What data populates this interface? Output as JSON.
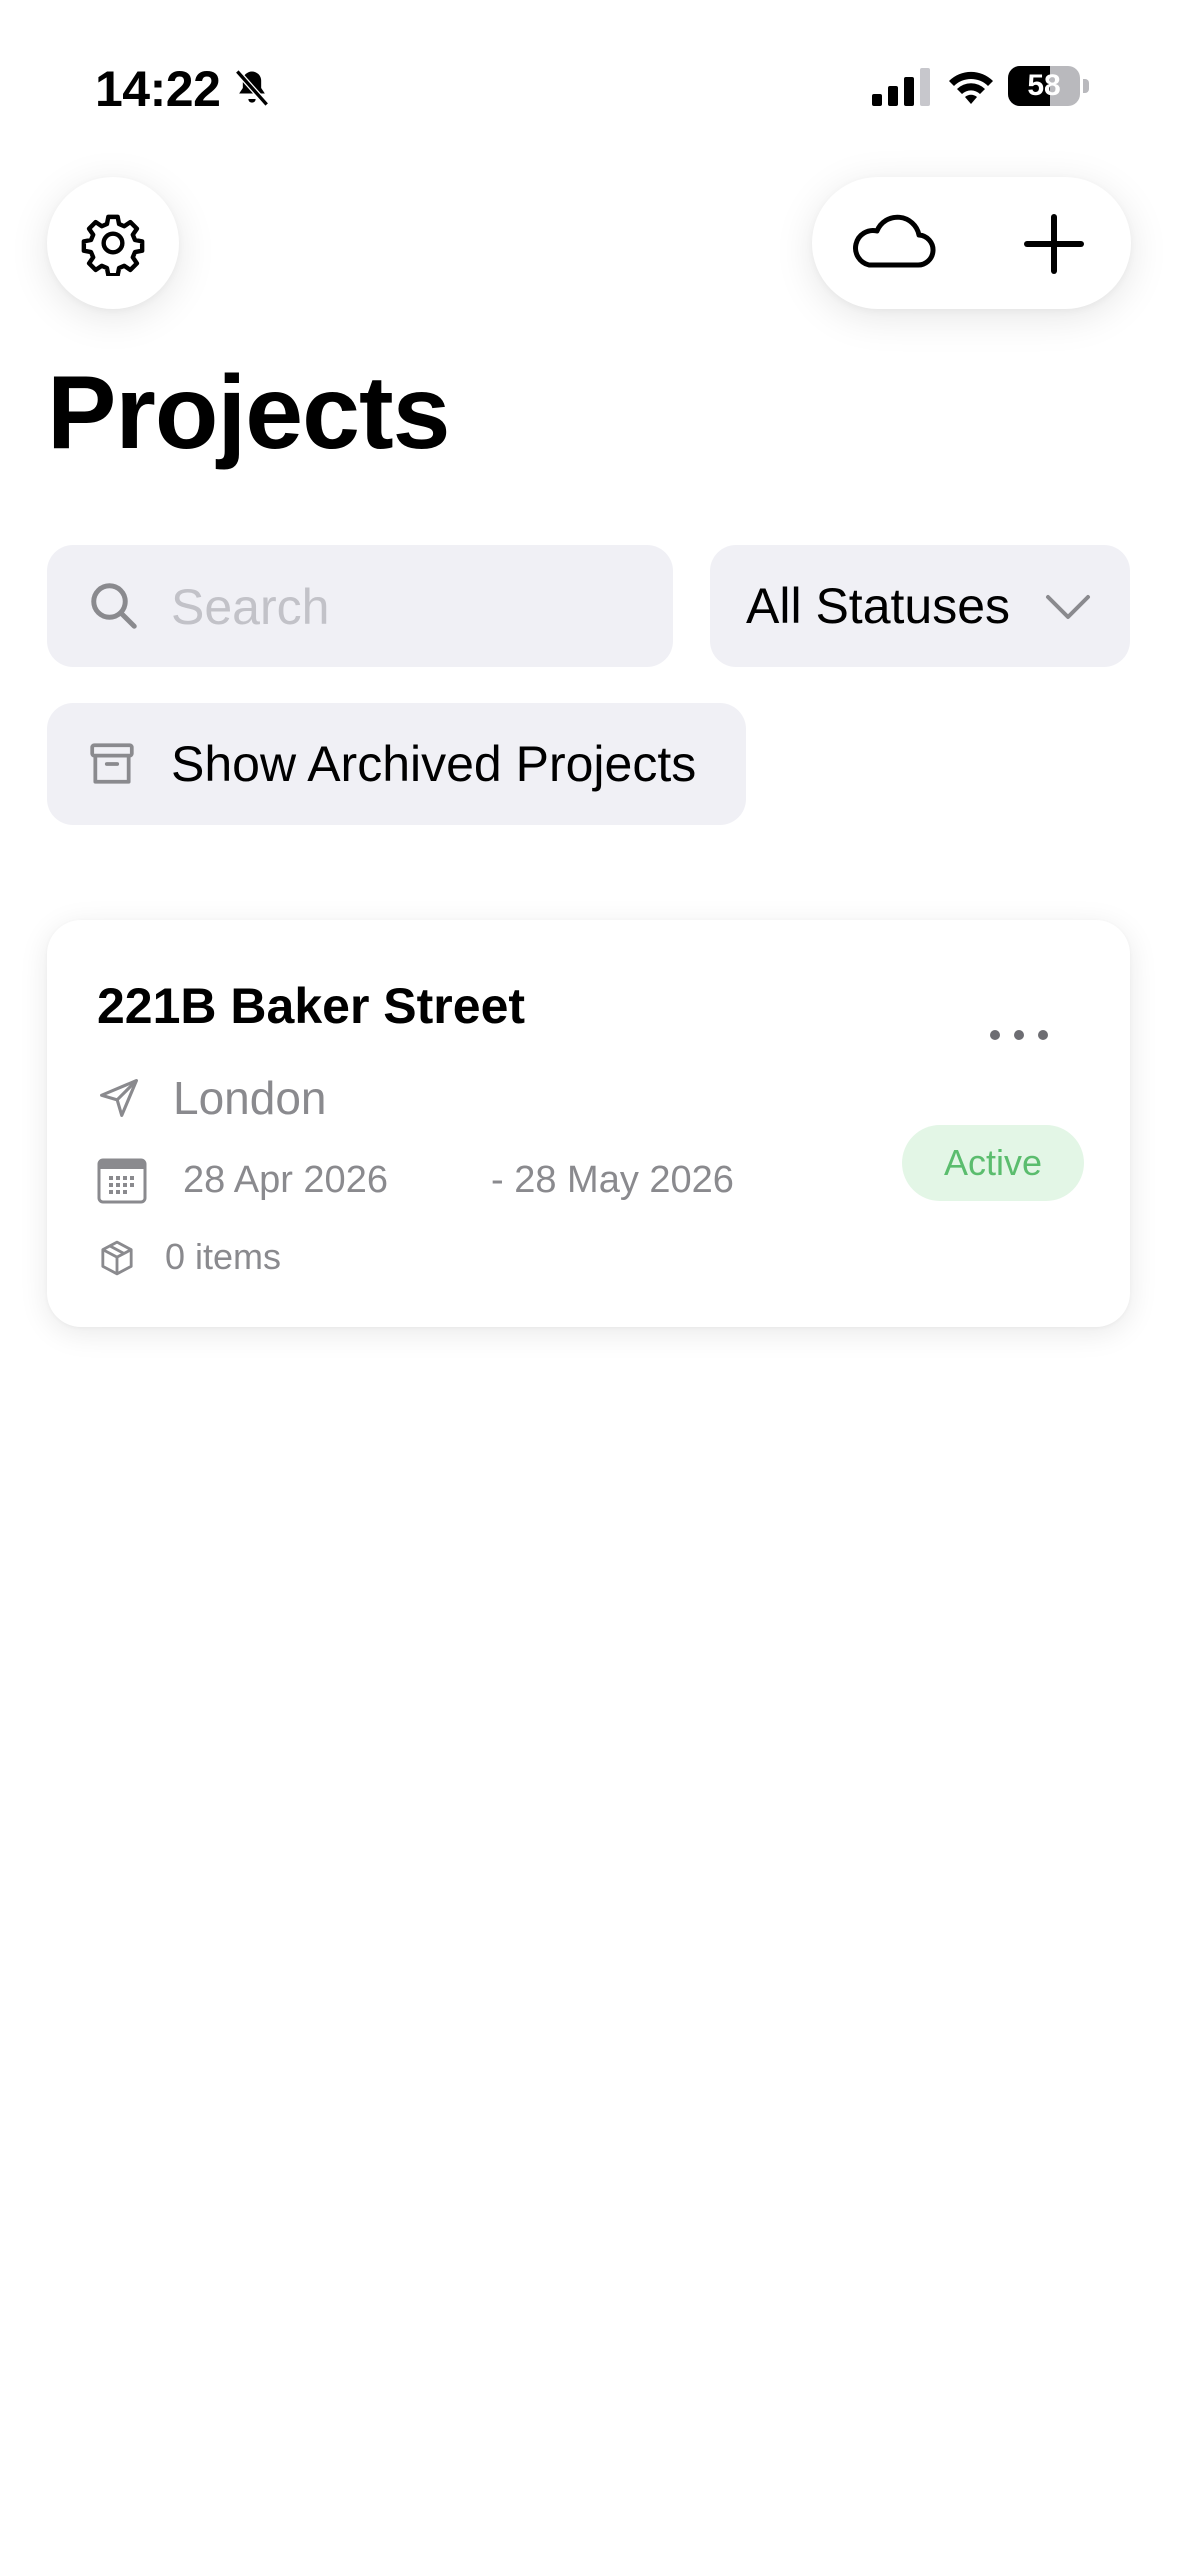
{
  "status_bar": {
    "time": "14:22",
    "battery_percent": 58,
    "battery_label": "58",
    "icons": [
      "bell-slash-icon",
      "cellular-signal-icon",
      "wifi-icon",
      "battery-icon"
    ]
  },
  "header": {
    "settings_icon": "gear-icon",
    "sync_icon": "cloud-icon",
    "add_icon": "plus-icon"
  },
  "page": {
    "title": "Projects"
  },
  "search": {
    "placeholder": "Search",
    "value": ""
  },
  "filter": {
    "selected": "All Statuses"
  },
  "archived_toggle": {
    "label": "Show Archived Projects"
  },
  "projects": [
    {
      "name": "221B Baker Street",
      "location": "London",
      "start_date": "28 Apr 2026",
      "end_date": "- 28 May 2026",
      "items": "0 items",
      "status": "Active"
    }
  ],
  "colors": {
    "background": "#ffffff",
    "control_background": "#f0f0f5",
    "muted_text": "#8a8a8e",
    "placeholder_text": "#c2c2c8",
    "active_badge_bg": "#e3f6e6",
    "active_badge_text": "#5bbd6e"
  }
}
